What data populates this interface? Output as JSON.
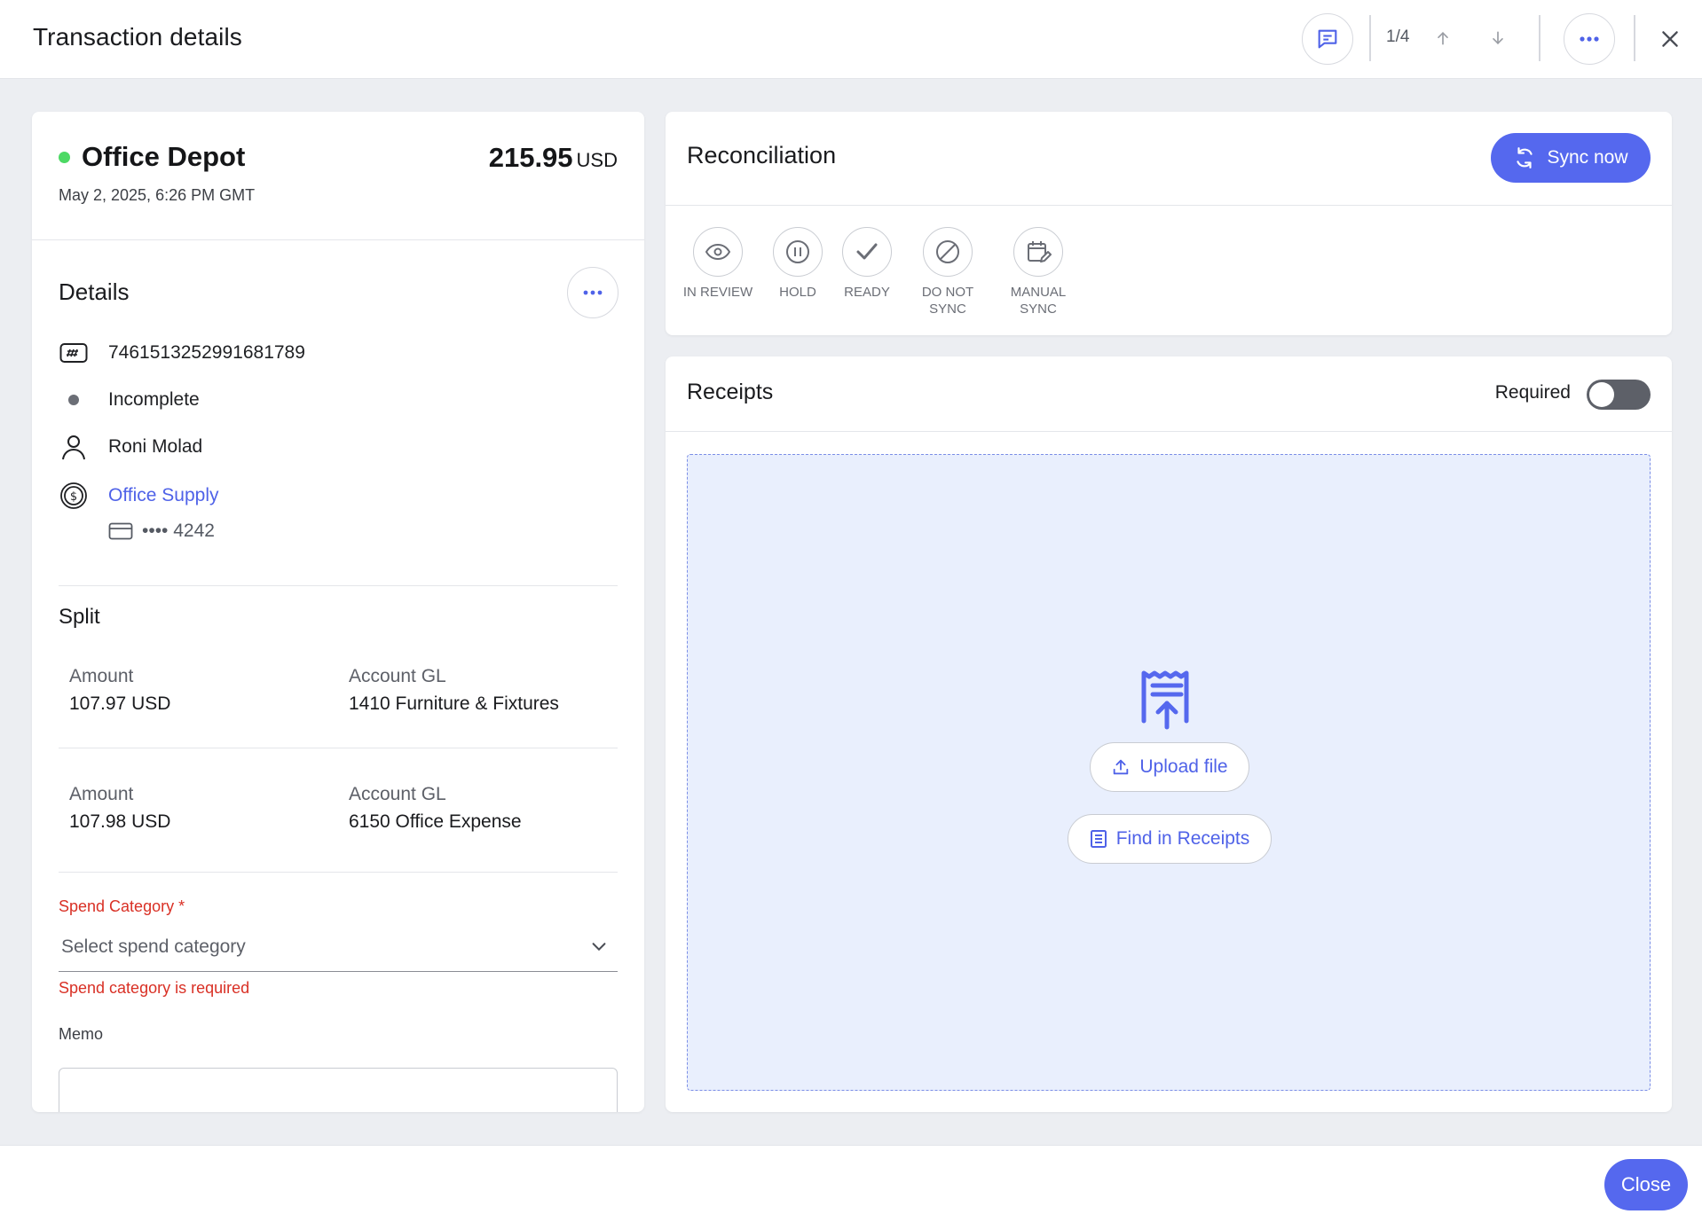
{
  "header": {
    "title": "Transaction details",
    "pager": "1/4"
  },
  "transaction": {
    "merchant": "Office Depot",
    "amount": "215.95",
    "currency": "USD",
    "date": "May 2, 2025, 6:26 PM GMT"
  },
  "details": {
    "title": "Details",
    "transaction_id": "7461513252991681789",
    "status": "Incomplete",
    "user": "Roni Molad",
    "card_program": "Office Supply",
    "card_mask": "•••• 4242"
  },
  "split": {
    "title": "Split",
    "rows": [
      {
        "amount_label": "Amount",
        "amount": "107.97 USD",
        "gl_label": "Account GL",
        "gl": "1410 Furniture & Fixtures"
      },
      {
        "amount_label": "Amount",
        "amount": "107.98 USD",
        "gl_label": "Account GL",
        "gl": "6150 Office Expense"
      }
    ]
  },
  "spend_category": {
    "label": "Spend Category *",
    "placeholder": "Select spend category",
    "error": "Spend category is required"
  },
  "memo": {
    "label": "Memo",
    "value": ""
  },
  "reconciliation": {
    "title": "Reconciliation",
    "sync_label": "Sync now",
    "steps": [
      {
        "label": "IN REVIEW",
        "icon": "eye-icon"
      },
      {
        "label": "HOLD",
        "icon": "pause-icon"
      },
      {
        "label": "READY",
        "icon": "check-icon"
      },
      {
        "label": "DO NOT SYNC",
        "icon": "block-icon"
      },
      {
        "label": "MANUAL SYNC",
        "icon": "calendar-edit-icon"
      }
    ]
  },
  "receipts": {
    "title": "Receipts",
    "required_label": "Required",
    "required_on": false,
    "upload_label": "Upload file",
    "find_label": "Find in Receipts"
  },
  "footer": {
    "close_label": "Close"
  },
  "colors": {
    "accent": "#5568ee",
    "link": "#4f62e8",
    "error": "#d93025",
    "status_ok": "#4cd964",
    "dropzone_bg": "#e9effd"
  }
}
